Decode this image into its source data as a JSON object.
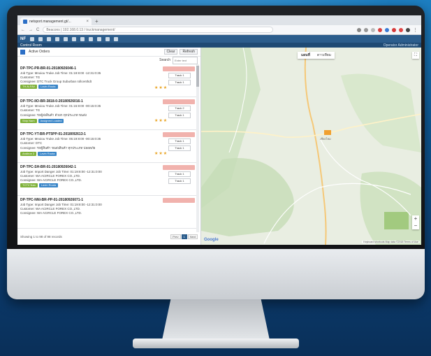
{
  "browser": {
    "tab_title": "netsport.management.gt/...",
    "tab_close": "×",
    "new_tab": "+",
    "nav_back": "←",
    "nav_forward": "→",
    "nav_reload": "C",
    "url": "Beacons | 192.168.0.13 / truckmanagement/"
  },
  "app": {
    "logo": "NF",
    "right_text": "",
    "panel_title": "Control Room",
    "user_info": "Operator Administrator"
  },
  "filter": {
    "checkbox_label": "Active Orders",
    "btn_clear": "Clear",
    "btn_refresh": "Refresh",
    "search_label": "Search",
    "search_placeholder": "Enter text"
  },
  "jobs": [
    {
      "id": "DP-TPC-PR-BR-01-20180926046-1",
      "type_line": "Job Type: Mnoiou Truke   Job Time: 01:19:8:00 -12:31:0:35",
      "customer": "Customer: TG",
      "consignee": "Consignee: DTC Truck Group Suburban rollcenthdt",
      "tags": [
        "TH-N-FAV",
        "Lavin Routa"
      ],
      "status": "",
      "btn1": "Track 1",
      "btn2": "Track 1"
    },
    {
      "id": "DP-TPC-IIO-BR-3818-0-20180926016-1",
      "type_line": "Job Type: Mnoiou Truke   Job Time: 01:15:8:00 -00:15:0:35",
      "customer": "Customer: TG",
      "consignee": "Consignee: รถตู้ส่งสินค้า ตัวยก ทุกประเภท ขนส่ง",
      "tags": [
        "Ship Nam",
        "Assigned Loaded"
      ],
      "status": "",
      "btn1": "Track 2",
      "btn2": "Track 1"
    },
    {
      "id": "DP-TPC-YT-BR-PT5PP-01-2018092613-1",
      "type_line": "Job Type: Mnoiou Truke   Job Time: 05:19:8:00 -00:15:0:35",
      "customer": "Customer: DTC",
      "consignee": "Consignee: รถตู้สินค้า ขนส่งสินค้า ทุกประเภท ปลอดภัย",
      "tags": [
        "Andiron 3",
        "Lavin Routa"
      ],
      "status": "",
      "btn1": "Track 1",
      "btn2": "Track 1"
    },
    {
      "id": "DP-TPC-SH-BR-01-20180926042-1",
      "type_line": "Job Type: Import Danger   Job Time: 01:19:8:00 -12:31:0:00",
      "customer": "Customer: WA ACIRCLE FOREX CO.,LTD.",
      "consignee": "Consignee: WA ACIRCLE FOREX CO.,LTD.",
      "tags": [
        "TCTV Nan",
        "Lavin Routa"
      ],
      "status": "",
      "btn1": "Track 1",
      "btn2": "Track 1"
    },
    {
      "id": "DP-TPC-NNI-BR-PP-01-20180926071-1",
      "type_line": "Job Type: Import Danger   Job Time: 01:19:8:00 -12:31:0:00",
      "customer": "Customer: WA ACIRCLE FOREX CO.,LTD.",
      "consignee": "Consignee: WA ACIRCLE FOREX CO.,LTD.",
      "tags": [
        "",
        ""
      ],
      "status": "",
      "btn1": "",
      "btn2": ""
    }
  ],
  "footer": {
    "summary": "Showing 1 to 98 of 98 records",
    "pages": [
      "Prev",
      "1",
      "Next"
    ]
  },
  "map": {
    "btn_map": "แผนที่",
    "btn_satellite": "ดาวเทียม",
    "google": "Google",
    "attribution": "Keyboard shortcuts   Map data ©2018   Terms of Use",
    "city_label": "เชียงใหม่",
    "zoom_in": "+",
    "zoom_out": "−",
    "fullscreen": "⛶"
  },
  "colors": {
    "toolbar": "#2c5d8c",
    "tag_green": "#7fb13a",
    "tag_blue": "#3a86c8",
    "status_pink": "#f1b2ad",
    "marker": "#f0a030"
  }
}
